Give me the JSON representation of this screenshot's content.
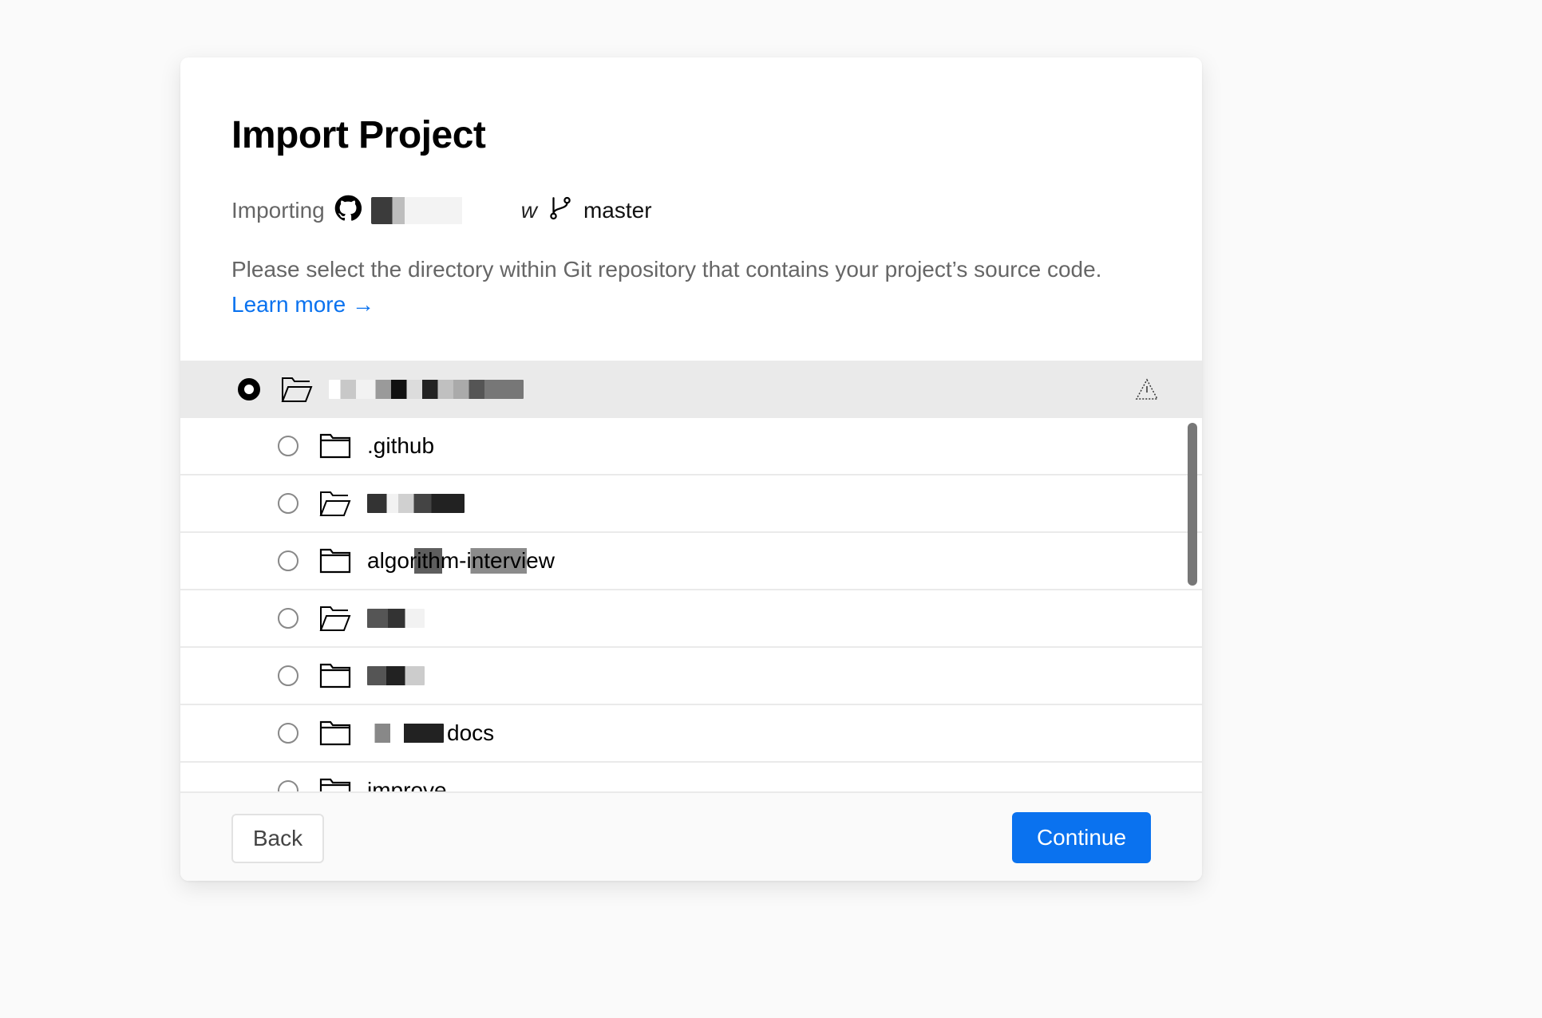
{
  "dialog": {
    "title": "Import Project",
    "importing_label": "Importing",
    "repo_suffix": "w",
    "branch": "master",
    "description": "Please select the directory within Git repository that contains your project’s source code.",
    "learn_more": "Learn more →"
  },
  "directories": [
    {
      "label": "",
      "selected": true,
      "root": true,
      "icon": "folder-open-icon"
    },
    {
      "label": ".github",
      "selected": false,
      "icon": "folder-icon"
    },
    {
      "label": "",
      "selected": false,
      "icon": "folder-open-icon"
    },
    {
      "label": "algorithm-interview",
      "selected": false,
      "icon": "folder-icon"
    },
    {
      "label": "",
      "selected": false,
      "icon": "folder-open-icon"
    },
    {
      "label": "",
      "selected": false,
      "icon": "folder-icon"
    },
    {
      "label": "docs",
      "selected": false,
      "icon": "folder-icon"
    },
    {
      "label": "improve",
      "selected": false,
      "icon": "folder-icon"
    }
  ],
  "footer": {
    "back_label": "Back",
    "continue_label": "Continue"
  },
  "colors": {
    "accent": "#0a72ef",
    "selected_row_bg": "#eaeaea"
  }
}
